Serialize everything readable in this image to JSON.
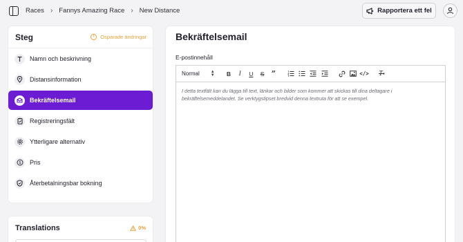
{
  "breadcrumb": [
    "Races",
    "Fannys Amazing Race",
    "New Distance"
  ],
  "header": {
    "report_label": "Rapportera ett fel"
  },
  "steps": {
    "title": "Steg",
    "unsaved_label": "Osparade ändringar",
    "items": [
      {
        "label": "Namn och beskrivning",
        "icon": "text-icon"
      },
      {
        "label": "Distansinformation",
        "icon": "location-pin-icon"
      },
      {
        "label": "Bekräftelsemail",
        "icon": "envelope-icon",
        "active": true
      },
      {
        "label": "Registreringsfält",
        "icon": "clipboard-icon"
      },
      {
        "label": "Ytterligare alternativ",
        "icon": "gear-icon"
      },
      {
        "label": "Pris",
        "icon": "dollar-icon"
      },
      {
        "label": "Återbetalningsbar bokning",
        "icon": "shield-check-icon"
      }
    ]
  },
  "translations": {
    "title": "Translations",
    "percent": "0%"
  },
  "main": {
    "title": "Bekräftelsemail",
    "field_label": "E-postinnehåll",
    "format_value": "Normal",
    "editor_placeholder": "I detta textfält kan du lägga till text, länkar och bilder som kommer att skickas till dina deltagare i bekräftelsemeddelandet. Se verktygstipset bredvid denna textruta för att se exempel."
  },
  "colors": {
    "accent": "#6c1cd3",
    "warning": "#e8a13a"
  }
}
